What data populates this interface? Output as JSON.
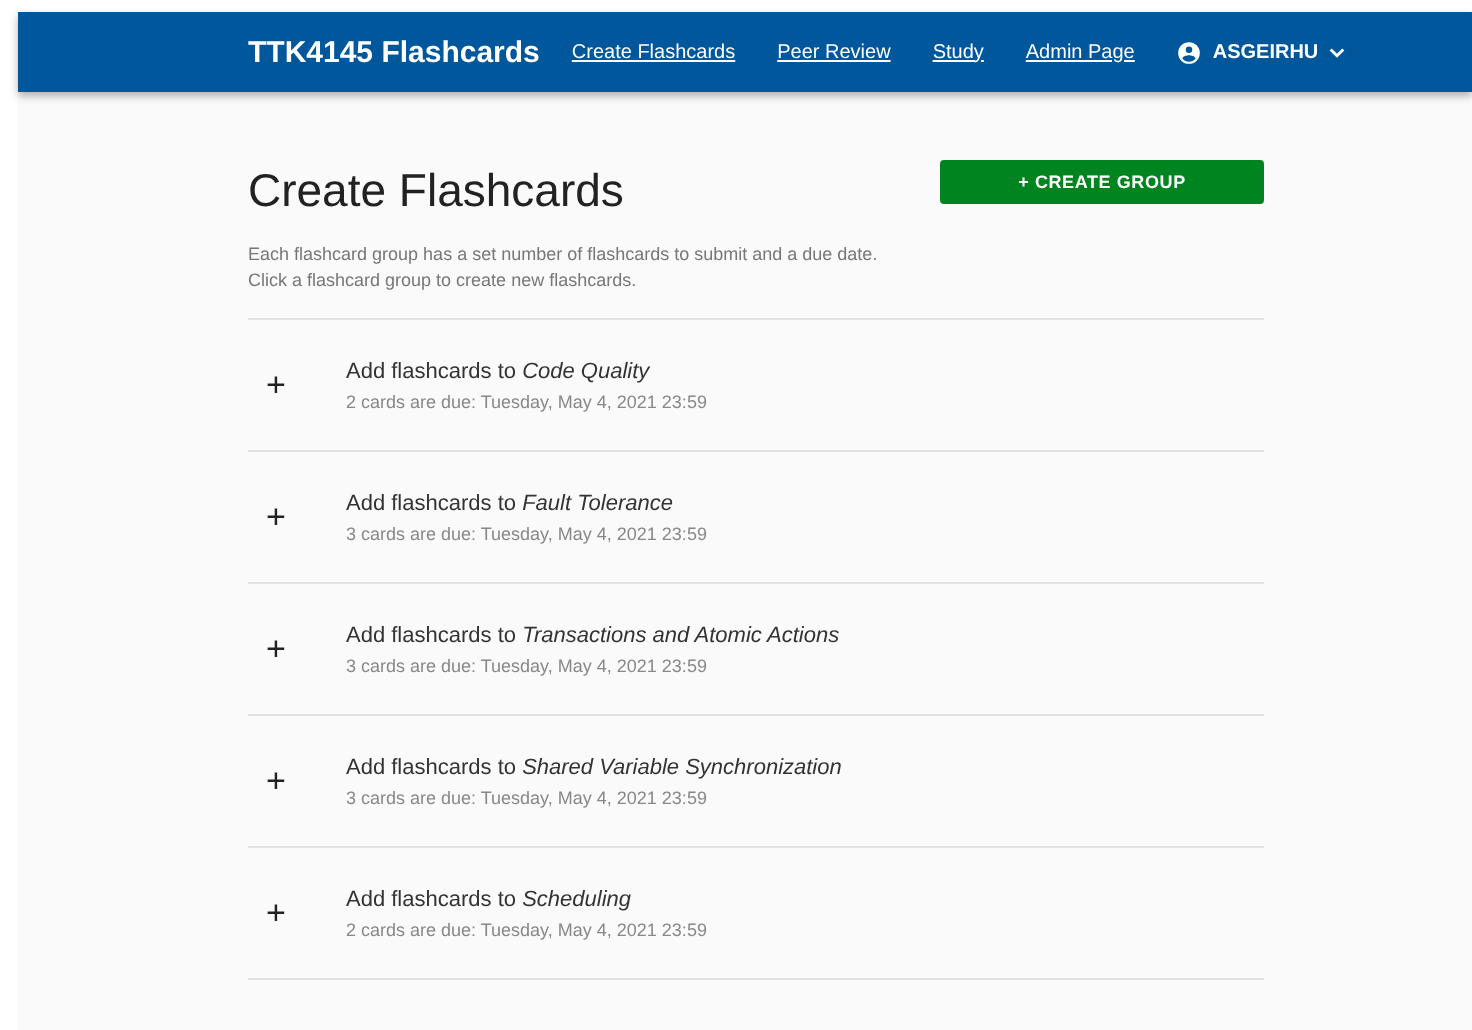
{
  "navbar": {
    "brand": "TTK4145 Flashcards",
    "links": [
      "Create Flashcards",
      "Peer Review",
      "Study",
      "Admin Page"
    ],
    "user": "ASGEIRHU"
  },
  "page": {
    "title": "Create Flashcards",
    "create_button": "+ CREATE GROUP",
    "description": [
      "Each flashcard group has a set number of flashcards to submit and a due date.",
      "Click a flashcard group to create new flashcards."
    ]
  },
  "groups": [
    {
      "icon": "+",
      "title": "Add flashcards to *Code Quality*",
      "due": "2 cards are due: Tuesday, May 4, 2021 23:59"
    },
    {
      "icon": "+",
      "title": "Add flashcards to *Fault Tolerance*",
      "due": "3 cards are due: Tuesday, May 4, 2021 23:59"
    },
    {
      "icon": "+",
      "title": "Add flashcards to *Transactions and Atomic Actions*",
      "due": "3 cards are due: Tuesday, May 4, 2021 23:59"
    },
    {
      "icon": "+",
      "title": "Add flashcards to *Shared Variable Synchronization*",
      "due": "3 cards are due: Tuesday, May 4, 2021 23:59"
    },
    {
      "icon": "+",
      "title": "Add flashcards to *Scheduling*",
      "due": "2 cards are due: Tuesday, May 4, 2021 23:59"
    }
  ]
}
